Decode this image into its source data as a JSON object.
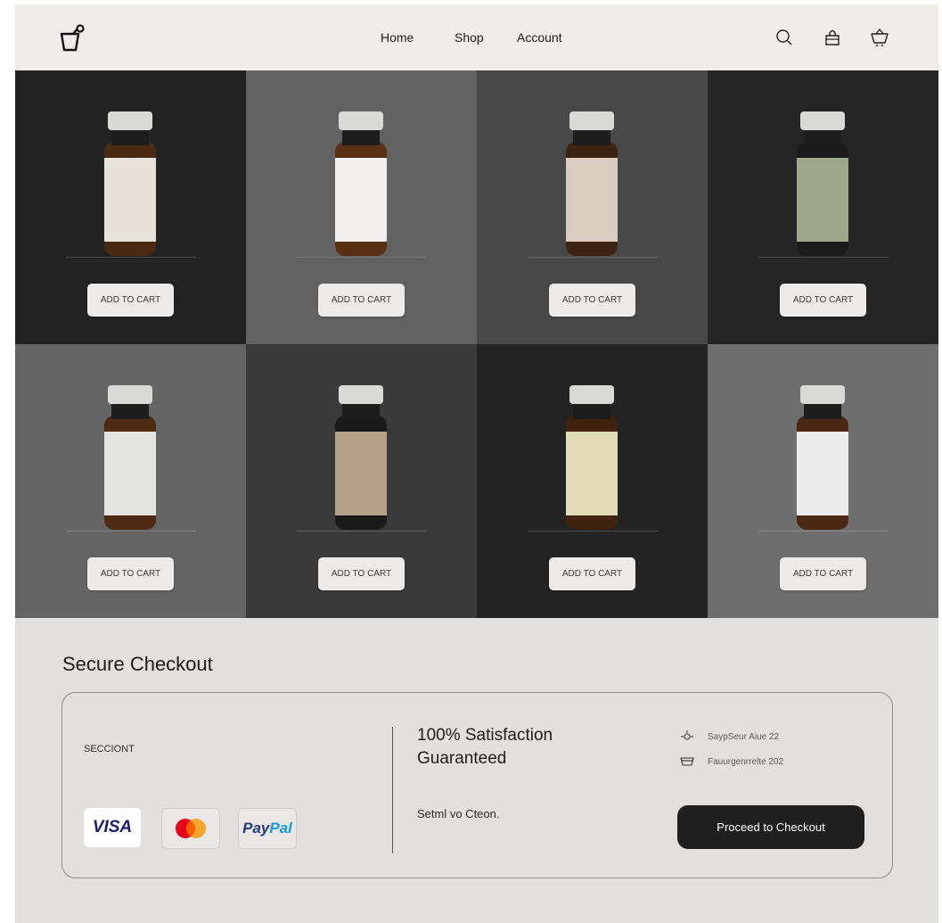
{
  "header": {
    "nav": [
      "Home",
      "Shop",
      "Account"
    ],
    "icons": [
      "bag-logo-icon",
      "search-icon",
      "bag-icon",
      "basket-icon"
    ]
  },
  "products": {
    "add_to_cart_label": "ADD TO CART",
    "tiles": [
      {
        "bg": "#232323",
        "label_color": "#e6e2d8",
        "glass_color": "#4b2a14"
      },
      {
        "bg": "#626262",
        "label_color": "#f1f0ee",
        "glass_color": "#5a3014"
      },
      {
        "bg": "#484848",
        "label_color": "#d8cdc0",
        "glass_color": "#3c2210"
      },
      {
        "bg": "#252525",
        "label_color": "#9ea88a",
        "glass_color": "#1c1c1c"
      },
      {
        "bg": "#646464",
        "label_color": "#e4e4de",
        "glass_color": "#4e2a12"
      },
      {
        "bg": "#3a3a3a",
        "label_color": "#b5a08a",
        "glass_color": "#1a1a1a"
      },
      {
        "bg": "#232323",
        "label_color": "#e3dab8",
        "glass_color": "#40230f"
      },
      {
        "bg": "#6e6e6e",
        "label_color": "#ececec",
        "glass_color": "#4a2814"
      }
    ]
  },
  "checkout": {
    "title": "Secure Checkout",
    "label": "SECCIONT",
    "payments": {
      "visa": "VISA",
      "paypal_a": "Pay",
      "paypal_b": "Pal"
    },
    "guarantee": "100% Satisfaction Guaranteed",
    "subtext": "Setml vo Cteon.",
    "info1": "SaypSeur Aiue 22",
    "info2": "Fauurgenrrelte 202",
    "proceed_label": "Proceed to Checkout"
  }
}
